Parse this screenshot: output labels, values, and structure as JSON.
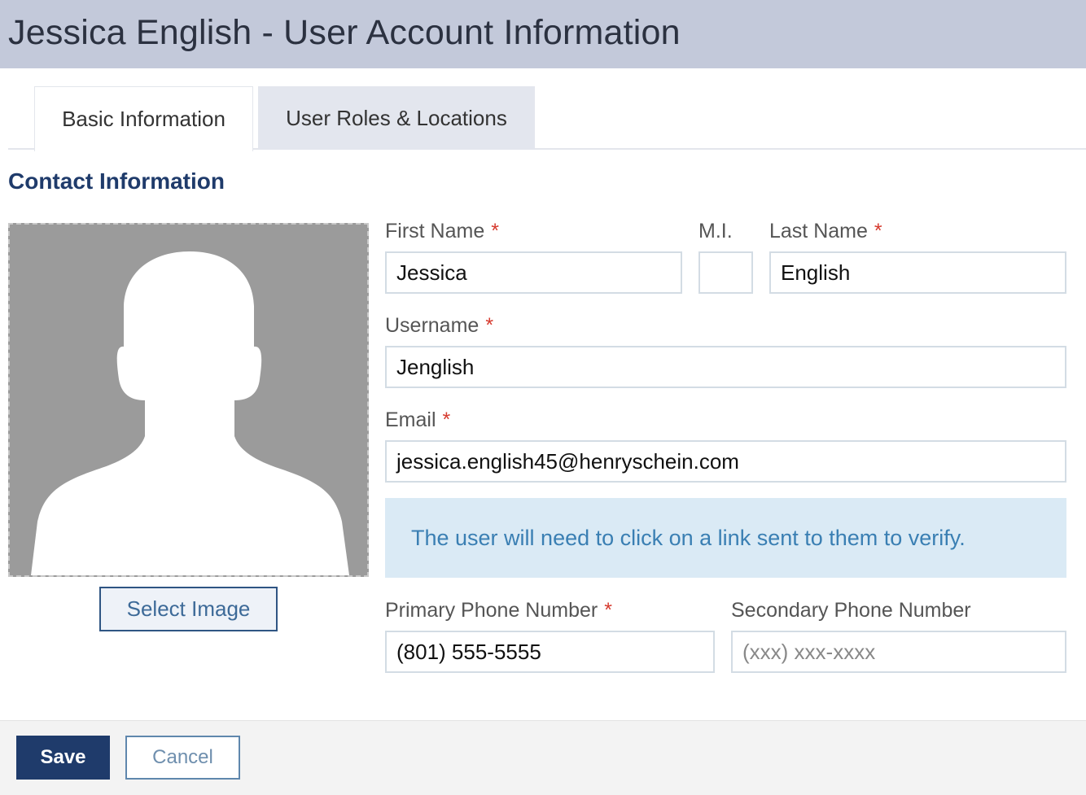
{
  "header": {
    "title": "Jessica English - User Account Information"
  },
  "tabs": [
    {
      "label": "Basic Information",
      "active": true
    },
    {
      "label": "User Roles & Locations",
      "active": false
    }
  ],
  "section": {
    "title": "Contact Information"
  },
  "photo": {
    "icon": "avatar-silhouette-icon",
    "select_label": "Select Image"
  },
  "form": {
    "first_name": {
      "label": "First Name",
      "required_mark": "*",
      "value": "Jessica"
    },
    "middle_initial": {
      "label": "M.I.",
      "value": ""
    },
    "last_name": {
      "label": "Last Name",
      "required_mark": "*",
      "value": "English"
    },
    "username": {
      "label": "Username",
      "required_mark": "*",
      "value": "Jenglish"
    },
    "email": {
      "label": "Email",
      "required_mark": "*",
      "value": "jessica.english45@henryschein.com"
    },
    "verify_notice": "The user will need to click on a link sent to them to verify.",
    "primary_phone": {
      "label": "Primary Phone Number",
      "required_mark": "*",
      "value": "(801) 555-5555"
    },
    "secondary_phone": {
      "label": "Secondary Phone Number",
      "placeholder": "(xxx) xxx-xxxx",
      "value": ""
    }
  },
  "footer": {
    "save_label": "Save",
    "cancel_label": "Cancel"
  },
  "colors": {
    "title_bar": "#c3c9da",
    "primary": "#1f3b6b",
    "required": "#d63a2e",
    "info_bg": "#daeaf5",
    "info_text": "#3a7fb3"
  }
}
